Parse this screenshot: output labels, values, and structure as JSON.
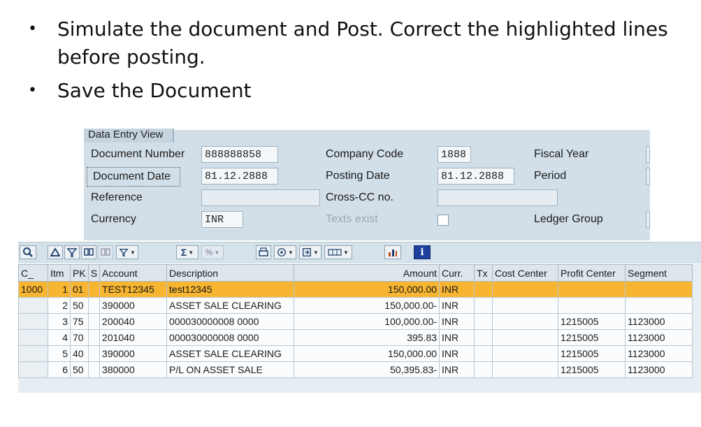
{
  "bullets": [
    "Simulate the document and Post. Correct the highlighted lines before posting.",
    "Save the Document"
  ],
  "panel": {
    "tab": "Data Entry View",
    "document_number_label": "Document Number",
    "document_number": "888888858",
    "company_code_label": "Company Code",
    "company_code": "1888",
    "fiscal_year_label": "Fiscal Year",
    "document_date_label": "Document Date",
    "document_date": "81.12.2888",
    "posting_date_label": "Posting Date",
    "posting_date": "81.12.2888",
    "period_label": "Period",
    "reference_label": "Reference",
    "cross_cc_label": "Cross-CC no.",
    "currency_label": "Currency",
    "currency": "INR",
    "texts_exist_label": "Texts exist",
    "ledger_group_label": "Ledger Group"
  },
  "toolbar": {
    "icons": [
      "details-icon",
      "delete-row-icon",
      "filter-icon",
      "find-icon",
      "find-next-icon",
      "set-filter-icon",
      "sum-icon",
      "subtotal-icon",
      "print-icon",
      "change-layout-icon",
      "export-icon",
      "views-icon",
      "graphic-icon",
      "info-icon"
    ]
  },
  "table": {
    "headers": [
      "C_",
      "Itm",
      "PK",
      "S",
      "Account",
      "Description",
      "Amount",
      "Curr.",
      "Tx",
      "Cost Center",
      "Profit Center",
      "Segment"
    ],
    "rows": [
      {
        "cc": "1000",
        "itm": "1",
        "pk": "01",
        "s": "",
        "account": "TEST12345",
        "description": "test12345",
        "amount": "150,000.00",
        "curr": "INR",
        "tx": "",
        "cost_center": "",
        "profit_center": "",
        "segment": ""
      },
      {
        "cc": "",
        "itm": "2",
        "pk": "50",
        "s": "",
        "account": "390000",
        "description": "ASSET SALE CLEARING",
        "amount": "150,000.00-",
        "curr": "INR",
        "tx": "",
        "cost_center": "",
        "profit_center": "",
        "segment": ""
      },
      {
        "cc": "",
        "itm": "3",
        "pk": "75",
        "s": "",
        "account": "200040",
        "description": "000030000008 0000",
        "amount": "100,000.00-",
        "curr": "INR",
        "tx": "",
        "cost_center": "",
        "profit_center": "1215005",
        "segment": "1123000"
      },
      {
        "cc": "",
        "itm": "4",
        "pk": "70",
        "s": "",
        "account": "201040",
        "description": "000030000008 0000",
        "amount": "395.83",
        "curr": "INR",
        "tx": "",
        "cost_center": "",
        "profit_center": "1215005",
        "segment": "1123000"
      },
      {
        "cc": "",
        "itm": "5",
        "pk": "40",
        "s": "",
        "account": "390000",
        "description": "ASSET SALE CLEARING",
        "amount": "150,000.00",
        "curr": "INR",
        "tx": "",
        "cost_center": "",
        "profit_center": "1215005",
        "segment": "1123000"
      },
      {
        "cc": "",
        "itm": "6",
        "pk": "50",
        "s": "",
        "account": "380000",
        "description": "P/L ON ASSET SALE",
        "amount": "50,395.83-",
        "curr": "INR",
        "tx": "",
        "cost_center": "",
        "profit_center": "1215005",
        "segment": "1123000"
      }
    ],
    "highlight_color": "#f7b531"
  }
}
